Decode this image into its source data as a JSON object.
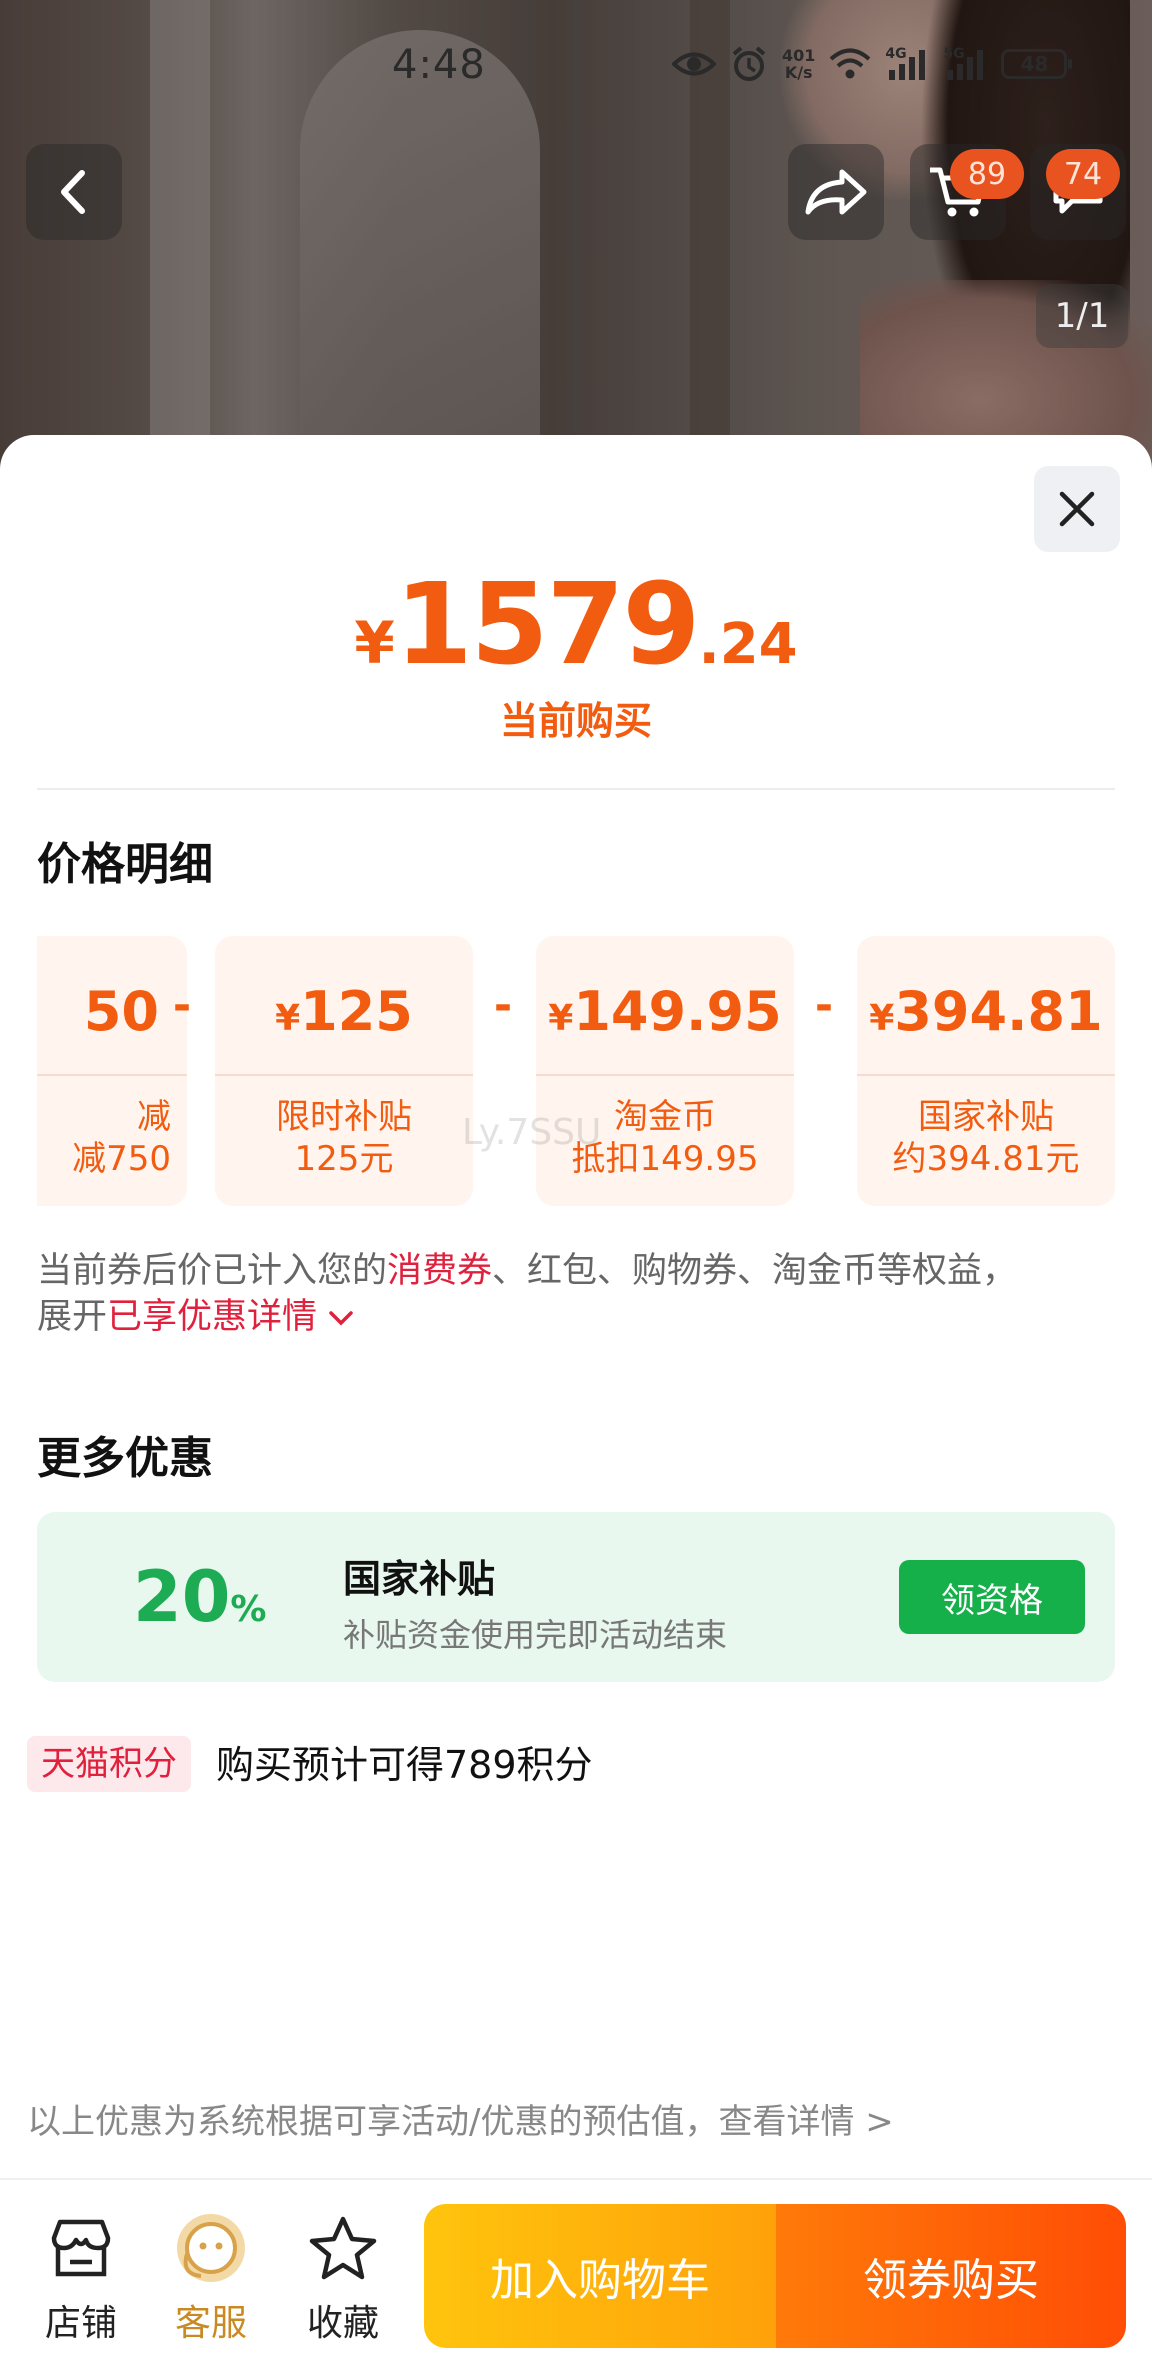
{
  "status_bar": {
    "time": "4:48",
    "net_speed_value": "401",
    "net_speed_unit": "K/s",
    "signal_4g": "4G",
    "signal_5g": "5G",
    "battery": "48"
  },
  "nav": {
    "cart_badge": "89",
    "message_badge": "74",
    "image_pager": "1/1"
  },
  "price": {
    "currency": "¥",
    "integer": "1579",
    "decimal": ".24",
    "label": "当前购买"
  },
  "breakdown": {
    "title": "价格明细",
    "operator": "-",
    "items": [
      {
        "currency": "",
        "amount": "50",
        "label_line1": "减",
        "label_line2": "减750"
      },
      {
        "currency": "¥",
        "amount": "125",
        "label_line1": "限时补贴",
        "label_line2": "125元"
      },
      {
        "currency": "¥",
        "amount": "149.95",
        "label_line1": "淘金币",
        "label_line2": "抵扣149.95"
      },
      {
        "currency": "¥",
        "amount": "394.81",
        "label_line1": "国家补贴",
        "label_line2": "约394.81元"
      }
    ],
    "watermark": "Ly.7SSU"
  },
  "note": {
    "part1": "当前券后价已计入您的",
    "highlight1": "消费券",
    "part2": "、红包、购物券、淘金币等权益，",
    "part3": "展开",
    "highlight2": "已享优惠详情"
  },
  "more_discount": {
    "title": "更多优惠",
    "percent": "20",
    "percent_sign": "%",
    "name": "国家补贴",
    "desc": "补贴资金使用完即活动结束",
    "button": "领资格"
  },
  "points": {
    "tag": "天猫积分",
    "text": "购买预计可得789积分"
  },
  "footnote": "以上优惠为系统根据可享活动/优惠的预估值，查看详情 >",
  "bottom_bar": {
    "shop": "店铺",
    "service": "客服",
    "favorite": "收藏",
    "add_to_cart": "加入购物车",
    "buy": "领券购买"
  },
  "colors": {
    "accent_orange": "#f25c10",
    "highlight_red": "#e0213d",
    "promo_green": "#16b04b"
  }
}
